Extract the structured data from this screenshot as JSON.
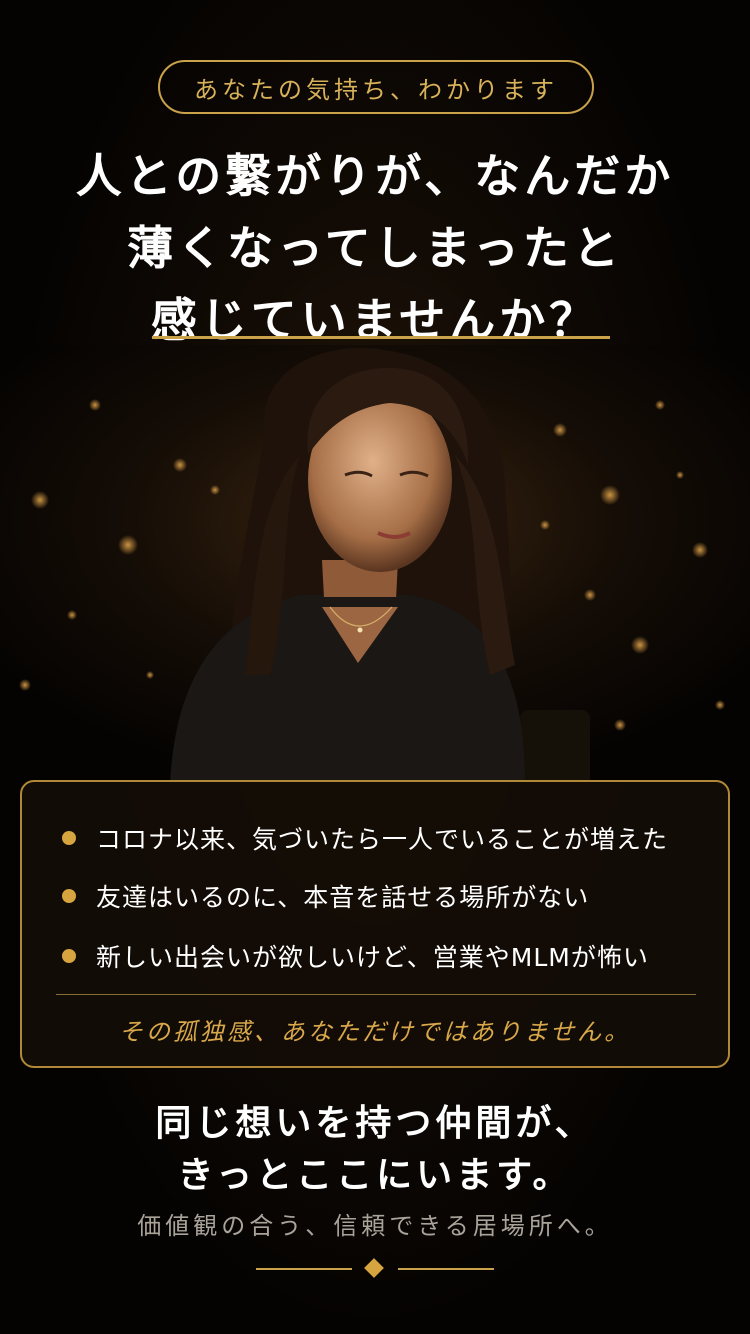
{
  "badge": {
    "text": "あなたの気持ち、わかります"
  },
  "headline": {
    "line1": "人との繋がりが、なんだか",
    "line2": "薄くなってしまったと",
    "line3": "感じていませんか？"
  },
  "box": {
    "items": [
      {
        "text": "コロナ以来、気づいたら一人でいることが増えた"
      },
      {
        "text": "友達はいるのに、本音を話せる場所がない"
      },
      {
        "text": "新しい出会いが欲しいけど、営業やMLMが怖い"
      }
    ],
    "closing": "その孤独感、あなただけではありません。"
  },
  "message": {
    "line1": "同じ想いを持つ仲間が、",
    "line2": "きっとここにいます。",
    "tagline": "価値観の合う、信頼できる居場所へ。"
  },
  "colors": {
    "accent": "#c9a24a",
    "background": "#050302",
    "bullet": "#d6a53f"
  },
  "icons": {
    "bullet": "gold-dot-icon",
    "ornament": "diamond-ornament-icon"
  }
}
